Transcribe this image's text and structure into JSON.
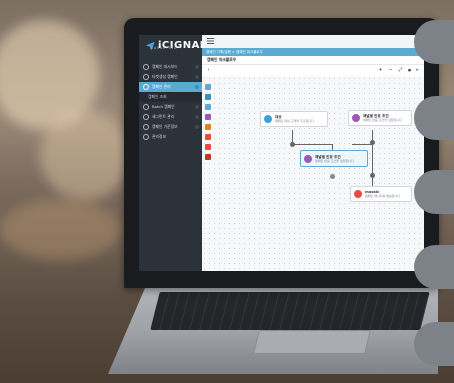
{
  "app": {
    "logo_text": "iCIGNAL",
    "logo_sub": "MARKETING"
  },
  "sidebar": {
    "items": [
      {
        "label": "캠페인 대시보드",
        "state": "normal"
      },
      {
        "label": "타겟생성 캠페인",
        "state": "normal"
      },
      {
        "label": "캠페인 관리",
        "state": "active"
      },
      {
        "label": "캠페인 조회",
        "state": "sub"
      },
      {
        "label": "Batch 캠페인",
        "state": "normal"
      },
      {
        "label": "세그먼트 관리",
        "state": "normal"
      },
      {
        "label": "캠페인 기준정보",
        "state": "normal"
      },
      {
        "label": "관리정보",
        "state": "normal"
      }
    ]
  },
  "breadcrumb": "캠페인 기획/실행 > 캠페인 워크플로우",
  "page_title": "캠페인 워크플로우",
  "toolbar": {
    "collapse": "›",
    "zoom_in": "+",
    "zoom_out": "−",
    "fit": "⤢",
    "lock": "■",
    "pointer": "▸"
  },
  "canvas": {
    "nodes": [
      {
        "title": "대상",
        "desc": "캠페인 대상 고객을 추출합니다",
        "color": "#3aa2d8",
        "selected": false
      },
      {
        "title": "채널별 반응 조건",
        "desc": "캠페인 반응 조건을 설정합니다",
        "color": "#9b59b6",
        "selected": false
      },
      {
        "title": "채널별 반응 조건",
        "desc": "캠페인 반응 조건을 설정합니다",
        "color": "#9b59b6",
        "selected": true
      },
      {
        "title": "mosaic",
        "desc": "캠페인 메시지를 발송합니다",
        "color": "#e74c3c",
        "selected": false
      }
    ],
    "palette_colors": [
      "#5aaad3",
      "#3a8fbd",
      "#5aaad3",
      "#9b59b6",
      "#e67e22",
      "#e74c3c",
      "#e74c3c",
      "#c0392b"
    ]
  }
}
